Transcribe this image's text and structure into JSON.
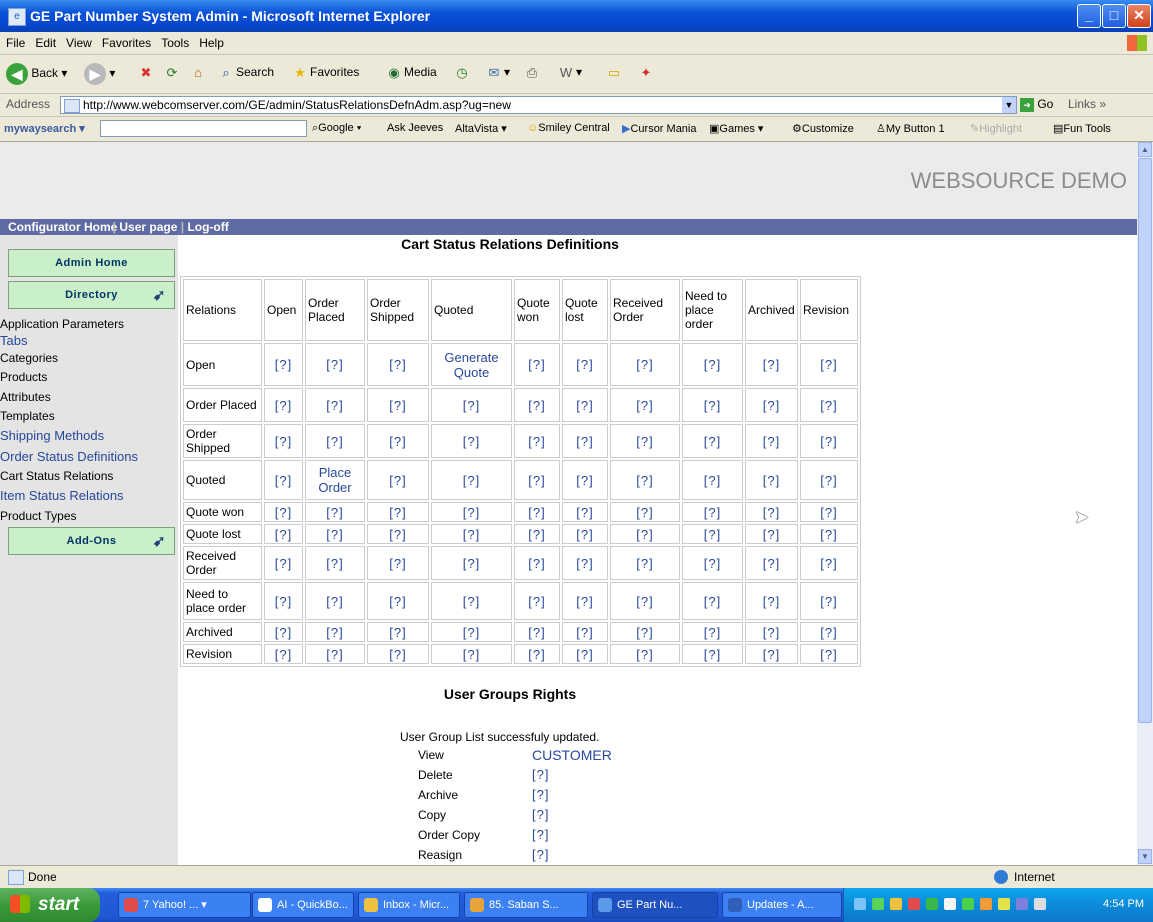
{
  "window": {
    "title": "GE Part Number System Admin - Microsoft Internet Explorer"
  },
  "menu": [
    "File",
    "Edit",
    "View",
    "Favorites",
    "Tools",
    "Help"
  ],
  "toolbar": {
    "back": "Back",
    "search": "Search",
    "favorites": "Favorites",
    "media": "Media"
  },
  "address": {
    "label": "Address",
    "url": "http://www.webcomserver.com/GE/admin/StatusRelationsDefnAdm.asp?ug=new",
    "go": "Go",
    "links": "Links"
  },
  "searchbar": {
    "brand": "mywaysearch",
    "items": [
      "Google",
      "Ask Jeeves",
      "AltaVista",
      "Smiley Central",
      "Cursor Mania",
      "Games",
      "Customize",
      "My Button 1",
      "Highlight",
      "Fun Tools"
    ]
  },
  "page": {
    "brand": "WEBSOURCE DEMO",
    "nav": [
      "Configurator Home",
      "User page",
      "Log-off"
    ],
    "sidebar": {
      "admin_home": "Admin Home",
      "directory": "Directory",
      "addons": "Add-Ons",
      "links": [
        "Application Parameters",
        "Tabs",
        "Categories",
        "Products",
        "Attributes",
        "Templates",
        "Shipping Methods",
        "Order Status Definitions",
        "Cart Status Relations",
        "Item Status Relations",
        "Product Types"
      ]
    },
    "cart_title": "Cart Status Relations Definitions",
    "columns": [
      "Relations",
      "Open",
      "Order Placed",
      "Order Shipped",
      "Quoted",
      "Quote won",
      "Quote lost",
      "Received Order",
      "Need to place order",
      "Archived",
      "Revision"
    ],
    "rows": [
      {
        "label": "Open",
        "cells": [
          "[?]",
          "[?]",
          "[?]",
          "Generate Quote",
          "[?]",
          "[?]",
          "[?]",
          "[?]",
          "[?]",
          "[?]"
        ]
      },
      {
        "label": "Order Placed",
        "cells": [
          "[?]",
          "[?]",
          "[?]",
          "[?]",
          "[?]",
          "[?]",
          "[?]",
          "[?]",
          "[?]",
          "[?]"
        ]
      },
      {
        "label": "Order Shipped",
        "cells": [
          "[?]",
          "[?]",
          "[?]",
          "[?]",
          "[?]",
          "[?]",
          "[?]",
          "[?]",
          "[?]",
          "[?]"
        ]
      },
      {
        "label": "Quoted",
        "cells": [
          "[?]",
          "Place Order",
          "[?]",
          "[?]",
          "[?]",
          "[?]",
          "[?]",
          "[?]",
          "[?]",
          "[?]"
        ]
      },
      {
        "label": "Quote won",
        "cells": [
          "[?]",
          "[?]",
          "[?]",
          "[?]",
          "[?]",
          "[?]",
          "[?]",
          "[?]",
          "[?]",
          "[?]"
        ]
      },
      {
        "label": "Quote lost",
        "cells": [
          "[?]",
          "[?]",
          "[?]",
          "[?]",
          "[?]",
          "[?]",
          "[?]",
          "[?]",
          "[?]",
          "[?]"
        ]
      },
      {
        "label": "Received Order",
        "cells": [
          "[?]",
          "[?]",
          "[?]",
          "[?]",
          "[?]",
          "[?]",
          "[?]",
          "[?]",
          "[?]",
          "[?]"
        ]
      },
      {
        "label": "Need to place order",
        "cells": [
          "[?]",
          "[?]",
          "[?]",
          "[?]",
          "[?]",
          "[?]",
          "[?]",
          "[?]",
          "[?]",
          "[?]"
        ]
      },
      {
        "label": "Archived",
        "cells": [
          "[?]",
          "[?]",
          "[?]",
          "[?]",
          "[?]",
          "[?]",
          "[?]",
          "[?]",
          "[?]",
          "[?]"
        ]
      },
      {
        "label": "Revision",
        "cells": [
          "[?]",
          "[?]",
          "[?]",
          "[?]",
          "[?]",
          "[?]",
          "[?]",
          "[?]",
          "[?]",
          "[?]"
        ]
      }
    ],
    "ug_title": "User Groups Rights",
    "ug_message": "User Group List successfuly updated.",
    "ug_rows": [
      {
        "label": "View",
        "value": "CUSTOMER"
      },
      {
        "label": "Delete",
        "value": "[?]"
      },
      {
        "label": "Archive",
        "value": "[?]"
      },
      {
        "label": "Copy",
        "value": "[?]"
      },
      {
        "label": "Order Copy",
        "value": "[?]"
      },
      {
        "label": "Reasign",
        "value": "[?]"
      }
    ]
  },
  "status": {
    "text": "Done",
    "zone": "Internet"
  },
  "taskbar": {
    "start": "start",
    "tasks": [
      "7 Yahoo! ...",
      "AI - QuickBo...",
      "Inbox - Micr...",
      "85. Saban S...",
      "GE Part Nu...",
      "Updates - A..."
    ],
    "clock": "4:54 PM"
  },
  "colors": {
    "title_blue": "#0a52d8",
    "nav_strip": "#616ba3",
    "link_blue": "#28489a",
    "sidebar_button": "#c9f0c9"
  }
}
